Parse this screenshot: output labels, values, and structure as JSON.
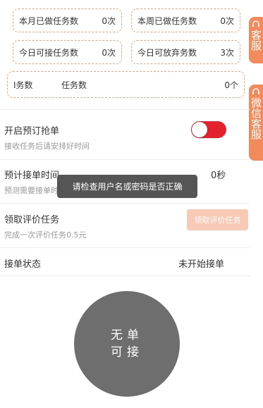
{
  "stats": [
    {
      "label": "本月已做任务数",
      "value": "0次"
    },
    {
      "label": "本周已做任务数",
      "value": "0次"
    },
    {
      "label": "今日可接任务数",
      "value": "0次"
    },
    {
      "label": "今日可放弃务数",
      "value": "3次"
    },
    {
      "label_left": "I务数",
      "label_right": "任务数",
      "value": "0个"
    }
  ],
  "side_tabs": {
    "service": "客服",
    "wechat_service": "微信客服"
  },
  "booking": {
    "title": "开启预订抢单",
    "subtitle": "接收任务后请安排好时间",
    "toggle_on": true
  },
  "estimate": {
    "title": "预计接单时间",
    "subtitle": "预测需要接单时间",
    "value": "0秒"
  },
  "toast": {
    "message": "请检查用户名或密码是否正确"
  },
  "evaluation": {
    "title": "领取评价任务",
    "subtitle": "完成一次评价任务0.5元",
    "button_label": "领取评价任务"
  },
  "status": {
    "label": "接单状态",
    "value": "未开始接单"
  },
  "main_button": {
    "line1": "无单",
    "line2": "可接"
  },
  "colors": {
    "accent": "#f38a5b",
    "toggle": "#e2222f",
    "toast_bg": "#555555",
    "circle_bg": "#6e6e6e"
  }
}
